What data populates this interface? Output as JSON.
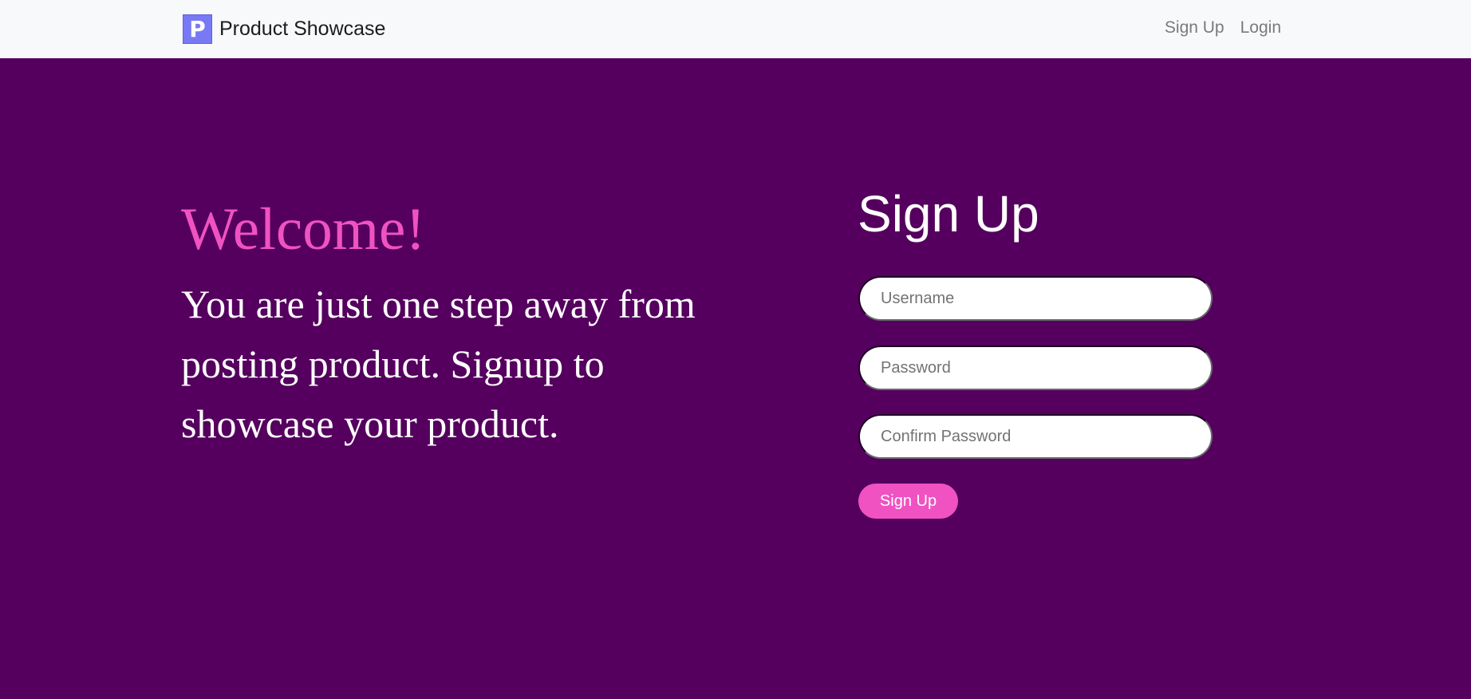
{
  "colors": {
    "background": "#55005e",
    "navbar": "#f8f9fa",
    "accent": "#f052c2",
    "logo": "#7779f5"
  },
  "navbar": {
    "brand_logo_letter": "P",
    "brand_logo_icon": "p-logo-icon",
    "brand_name": "Product Showcase",
    "links": [
      {
        "label": "Sign Up"
      },
      {
        "label": "Login"
      }
    ]
  },
  "hero": {
    "title": "Welcome!",
    "text": "You are just one step away from posting product. Signup to showcase your product."
  },
  "signup_form": {
    "title": "Sign Up",
    "username": {
      "placeholder": "Username",
      "value": ""
    },
    "password": {
      "placeholder": "Password",
      "value": ""
    },
    "confirm_password": {
      "placeholder": "Confirm Password",
      "value": ""
    },
    "submit_label": "Sign Up"
  }
}
